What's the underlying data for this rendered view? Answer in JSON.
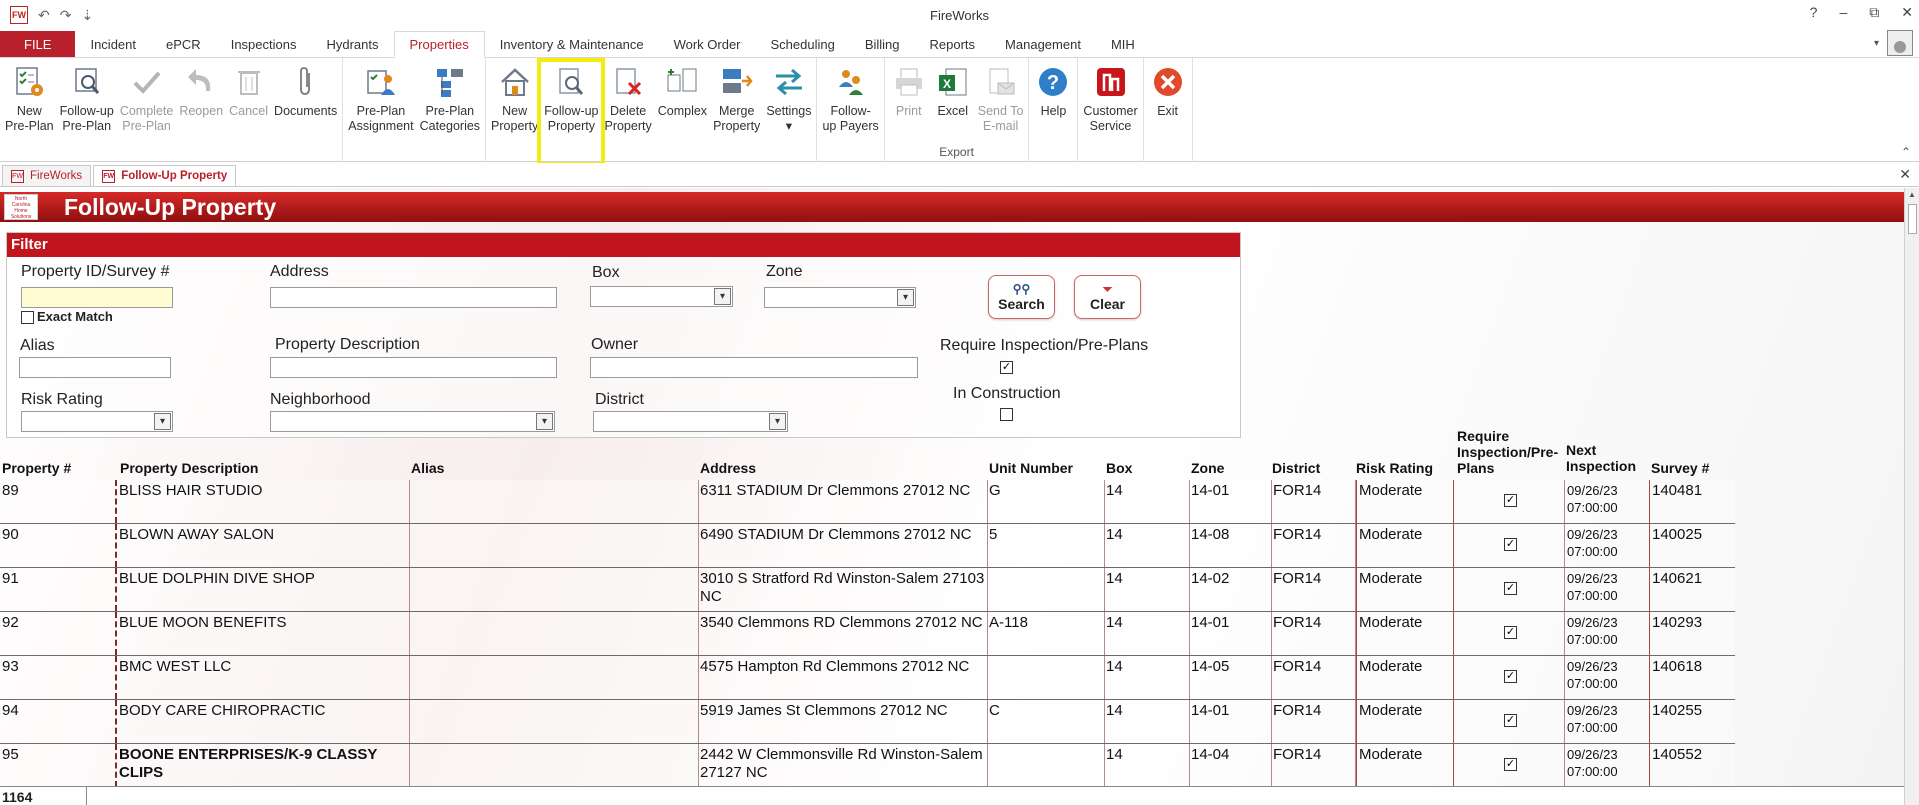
{
  "app": {
    "title": "FireWorks",
    "qat_undo": "↶",
    "qat_redo": "↷",
    "qat_customize": "⇣",
    "help": "?",
    "minimize": "–",
    "restore": "⧉",
    "close": "✕"
  },
  "ribbon_tabs": [
    "FILE",
    "Incident",
    "ePCR",
    "Inspections",
    "Hydrants",
    "Properties",
    "Inventory & Maintenance",
    "Work Order",
    "Scheduling",
    "Billing",
    "Reports",
    "Management",
    "MIH"
  ],
  "active_tab": "Properties",
  "ribbon": {
    "new_preplan": {
      "l1": "New",
      "l2": "Pre-Plan"
    },
    "followup_preplan": {
      "l1": "Follow-up",
      "l2": "Pre-Plan"
    },
    "complete_preplan": {
      "l1": "Complete",
      "l2": "Pre-Plan"
    },
    "reopen": {
      "l1": "Reopen"
    },
    "cancel": {
      "l1": "Cancel"
    },
    "documents": {
      "l1": "Documents"
    },
    "preplan_assignment": {
      "l1": "Pre-Plan",
      "l2": "Assignment"
    },
    "preplan_categories": {
      "l1": "Pre-Plan",
      "l2": "Categories"
    },
    "new_property": {
      "l1": "New",
      "l2": "Property"
    },
    "followup_property": {
      "l1": "Follow-up",
      "l2": "Property"
    },
    "delete_property": {
      "l1": "Delete",
      "l2": "Property"
    },
    "complex": {
      "l1": "Complex"
    },
    "merge_property": {
      "l1": "Merge",
      "l2": "Property"
    },
    "settings": {
      "l1": "Settings",
      "l2": "▾"
    },
    "followup_payers": {
      "l1": "Follow-",
      "l2": "up Payers"
    },
    "print": {
      "l1": "Print"
    },
    "excel": {
      "l1": "Excel"
    },
    "send_email": {
      "l1": "Send To",
      "l2": "E-mail"
    },
    "export_group": "Export",
    "help": {
      "l1": "Help"
    },
    "customer_service": {
      "l1": "Customer",
      "l2": "Service"
    },
    "exit": {
      "l1": "Exit"
    },
    "collapse": "⌃"
  },
  "doc_tabs": [
    "FireWorks",
    "Follow-Up Property"
  ],
  "logo_text": "North Carolina Home Solutions",
  "form_title": "Follow-Up Property",
  "filter": {
    "header": "Filter",
    "property_id_label": "Property ID/Survey #",
    "exact_match_label": "Exact Match",
    "address_label": "Address",
    "box_label": "Box",
    "zone_label": "Zone",
    "alias_label": "Alias",
    "property_description_label": "Property Description",
    "owner_label": "Owner",
    "risk_rating_label": "Risk Rating",
    "neighborhood_label": "Neighborhood",
    "district_label": "District",
    "require_inspection_label": "Require Inspection/Pre-Plans",
    "require_inspection_checked": "✓",
    "in_construction_label": "In Construction",
    "search_label": "Search",
    "clear_label": "Clear",
    "search_icon": "binoculars-icon",
    "clear_icon": "funnel-clear-icon"
  },
  "grid": {
    "headers": {
      "property": "Property #",
      "description": "Property Description",
      "alias": "Alias",
      "address": "Address",
      "unit": "Unit Number",
      "box": "Box",
      "zone": "Zone",
      "district": "District",
      "risk": "Risk Rating",
      "require": "Require Inspection/Pre-Plans",
      "next": "Next Inspection",
      "survey": "Survey #"
    },
    "rows": [
      {
        "property": "89",
        "description": "BLISS HAIR STUDIO",
        "alias": "",
        "address": "6311 STADIUM Dr Clemmons 27012 NC",
        "unit": "G",
        "box": "14",
        "zone": "14-01",
        "district": "FOR14",
        "risk": "Moderate",
        "require": "✓",
        "next": "09/26/23 07:00:00",
        "survey": "140481"
      },
      {
        "property": "90",
        "description": "BLOWN AWAY SALON",
        "alias": "",
        "address": "6490 STADIUM Dr Clemmons 27012 NC",
        "unit": "5",
        "box": "14",
        "zone": "14-08",
        "district": "FOR14",
        "risk": "Moderate",
        "require": "✓",
        "next": "09/26/23 07:00:00",
        "survey": "140025"
      },
      {
        "property": "91",
        "description": "BLUE DOLPHIN DIVE SHOP",
        "alias": "",
        "address": "3010 S Stratford Rd Winston-Salem 27103 NC",
        "unit": "",
        "box": "14",
        "zone": "14-02",
        "district": "FOR14",
        "risk": "Moderate",
        "require": "✓",
        "next": "09/26/23 07:00:00",
        "survey": "140621"
      },
      {
        "property": "92",
        "description": "BLUE MOON BENEFITS",
        "alias": "",
        "address": "3540 Clemmons RD Clemmons 27012 NC",
        "unit": "A-118",
        "box": "14",
        "zone": "14-01",
        "district": "FOR14",
        "risk": "Moderate",
        "require": "✓",
        "next": "09/26/23 07:00:00",
        "survey": "140293"
      },
      {
        "property": "93",
        "description": "BMC WEST LLC",
        "alias": "",
        "address": "4575 Hampton Rd Clemmons 27012 NC",
        "unit": "",
        "box": "14",
        "zone": "14-05",
        "district": "FOR14",
        "risk": "Moderate",
        "require": "✓",
        "next": "09/26/23 07:00:00",
        "survey": "140618"
      },
      {
        "property": "94",
        "description": "BODY CARE CHIROPRACTIC",
        "alias": "",
        "address": "5919 James St Clemmons 27012 NC",
        "unit": "C",
        "box": "14",
        "zone": "14-01",
        "district": "FOR14",
        "risk": "Moderate",
        "require": "✓",
        "next": "09/26/23 07:00:00",
        "survey": "140255"
      },
      {
        "property": "95",
        "description": "BOONE ENTERPRISES/K-9 CLASSY CLIPS",
        "alias": "",
        "address": "2442 W Clemmonsville Rd Winston-Salem 27127 NC",
        "unit": "",
        "box": "14",
        "zone": "14-04",
        "district": "FOR14",
        "risk": "Moderate",
        "require": "✓",
        "next": "09/26/23 07:00:00",
        "survey": "140552"
      }
    ]
  },
  "status": {
    "record_count": "1164"
  },
  "colors": {
    "brand_red": "#b8202b",
    "highlight_yellow": "#f3ec0f"
  }
}
